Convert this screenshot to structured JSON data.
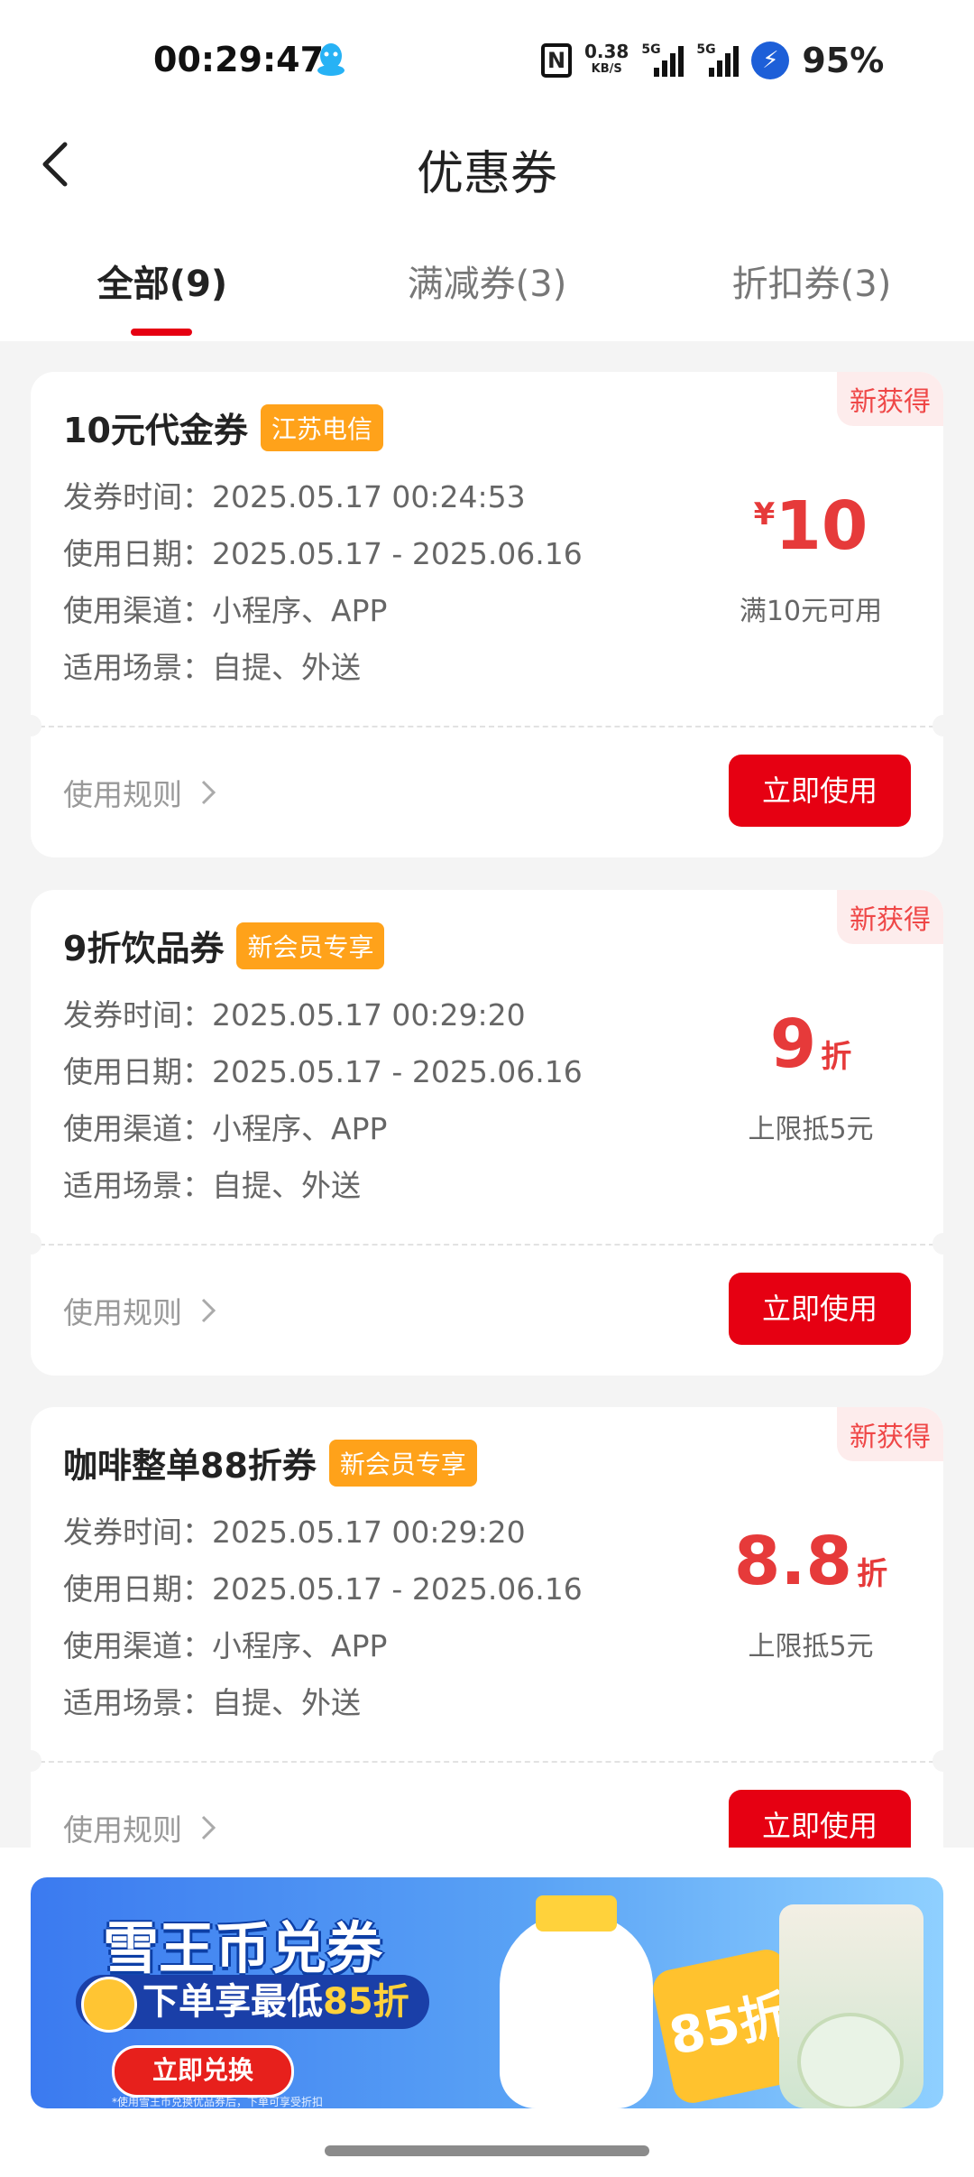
{
  "status_bar": {
    "time": "00:29:47",
    "nfc": "N",
    "net_speed_value": "0.38",
    "net_speed_unit": "KB/S",
    "sim1": "5G",
    "sim2": "5G",
    "battery": "95%"
  },
  "header": {
    "title": "优惠券"
  },
  "tabs": [
    {
      "label": "全部(9)",
      "active": true
    },
    {
      "label": "满减券(3)",
      "active": false
    },
    {
      "label": "折扣券(3)",
      "active": false
    }
  ],
  "coupons": [
    {
      "badge": "新获得",
      "title": "10元代金券",
      "tag": "江苏电信",
      "rows": [
        "发券时间：2025.05.17 00:24:53",
        "使用日期：2025.05.17 - 2025.06.16",
        "使用渠道：小程序、APP",
        "适用场景：自提、外送"
      ],
      "currency": "¥",
      "value": "10",
      "unit": "",
      "condition": "满10元可用",
      "rules": "使用规则",
      "button": "立即使用"
    },
    {
      "badge": "新获得",
      "title": "9折饮品券",
      "tag": "新会员专享",
      "rows": [
        "发券时间：2025.05.17 00:29:20",
        "使用日期：2025.05.17 - 2025.06.16",
        "使用渠道：小程序、APP",
        "适用场景：自提、外送"
      ],
      "currency": "",
      "value": "9",
      "unit": "折",
      "condition": "上限抵5元",
      "rules": "使用规则",
      "button": "立即使用"
    },
    {
      "badge": "新获得",
      "title": "咖啡整单88折券",
      "tag": "新会员专享",
      "rows": [
        "发券时间：2025.05.17 00:29:20",
        "使用日期：2025.05.17 - 2025.06.16",
        "使用渠道：小程序、APP",
        "适用场景：自提、外送"
      ],
      "currency": "",
      "value": "8.8",
      "unit": "折",
      "condition": "上限抵5元",
      "rules": "使用规则",
      "button": "立即使用"
    }
  ],
  "banner": {
    "title": "雪王币兑券",
    "subtitle_prefix": "下单享最低",
    "subtitle_highlight": "85折",
    "button": "立即兑换",
    "card_text": "85折",
    "note": "*使用雪王币兑换优品券后，下单可享受折扣"
  },
  "colors": {
    "accent": "#e60012",
    "price": "#e63a3a",
    "tag": "#ffa21a",
    "new_badge_bg": "#fdecec"
  }
}
